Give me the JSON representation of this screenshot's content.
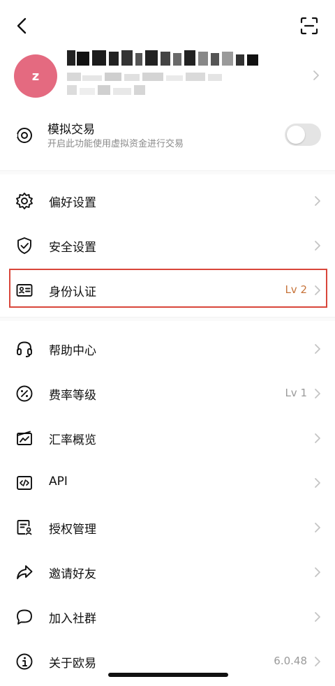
{
  "profile": {
    "avatar_letter": "z"
  },
  "simulated_trading": {
    "title": "模拟交易",
    "subtitle": "开启此功能使用虚拟资金进行交易",
    "enabled": false
  },
  "menu": {
    "preferences": {
      "label": "偏好设置",
      "icon": "gear-icon"
    },
    "security": {
      "label": "安全设置",
      "icon": "shield-check-icon"
    },
    "identity": {
      "label": "身份认证",
      "value": "Lv 2",
      "icon": "id-card-icon"
    },
    "help": {
      "label": "帮助中心",
      "icon": "headset-icon"
    },
    "fees": {
      "label": "费率等级",
      "value": "Lv 1",
      "icon": "percent-icon"
    },
    "exchange_rates": {
      "label": "汇率概览",
      "icon": "chart-card-icon"
    },
    "api": {
      "label": "API",
      "icon": "code-icon"
    },
    "authorization": {
      "label": "授权管理",
      "icon": "document-user-icon"
    },
    "invite": {
      "label": "邀请好友",
      "icon": "share-arrow-icon"
    },
    "community": {
      "label": "加入社群",
      "icon": "chat-bubble-icon"
    },
    "about": {
      "label": "关于欧易",
      "value": "6.0.48",
      "icon": "info-icon"
    }
  },
  "colors": {
    "avatar_bg": "#e46a80",
    "accent_value": "#c7743a",
    "highlight_border": "#d9463a"
  }
}
